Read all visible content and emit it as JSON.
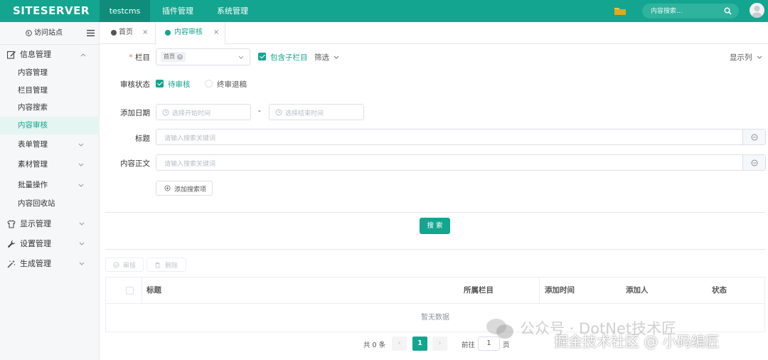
{
  "topbar": {
    "logo": "SiteServer",
    "tabs": [
      {
        "label": "testcms",
        "active": true
      },
      {
        "label": "插件管理",
        "active": false
      },
      {
        "label": "系统管理",
        "active": false
      }
    ],
    "search_placeholder": "内容搜索...",
    "accent_color": "#13a58f"
  },
  "sidebar": {
    "visit_site": "访问站点",
    "groups": [
      {
        "label": "信息管理",
        "icon": "edit-icon",
        "expanded": true,
        "items": [
          "内容管理",
          "栏目管理",
          "内容搜索",
          "内容审核",
          "表单管理",
          "素材管理",
          "批量操作",
          "内容回收站"
        ],
        "active_item": "内容审核"
      },
      {
        "label": "显示管理",
        "icon": "shirt-icon"
      },
      {
        "label": "设置管理",
        "icon": "wrench-icon"
      },
      {
        "label": "生成管理",
        "icon": "magic-wand-icon"
      }
    ],
    "sub_group_expandables": [
      "表单管理",
      "素材管理",
      "批量操作"
    ]
  },
  "page_tabs": [
    {
      "label": "首页",
      "close": "×",
      "active": false
    },
    {
      "label": "内容审核",
      "close": "×",
      "active": true
    }
  ],
  "form": {
    "channel_label": "栏目",
    "channel_required": "*",
    "channel_tag": "首页",
    "include_children": "包含子栏目",
    "filter": "筛选",
    "show_columns": "显示列",
    "check_status_label": "审核状态",
    "pending_option": "待审核",
    "rejected_option": "终审退稿",
    "add_date_label": "添加日期",
    "start_date_placeholder": "选择开始时间",
    "date_separator": "-",
    "end_date_placeholder": "选择结束时间",
    "title_label": "标题",
    "title_placeholder": "请输入搜索关键词",
    "body_label": "内容正文",
    "body_placeholder": "请输入搜索关键词",
    "add_search_item": "添加搜索项",
    "search_button": "搜 索"
  },
  "actions": {
    "approve": "审核",
    "delete": "删除"
  },
  "table": {
    "columns": [
      "标题",
      "所属栏目",
      "添加时间",
      "添加人",
      "状态"
    ],
    "empty_text": "暂无数据"
  },
  "pagination": {
    "total": "共 0 条",
    "prev": "‹",
    "current_page": "1",
    "next": "›",
    "goto_label": "前往",
    "goto_value": "1",
    "page_unit": "页"
  },
  "watermark": {
    "line1": "公众号 · DotNet技术匠",
    "line2": "掘金技术社区 @ 小码编匠"
  }
}
